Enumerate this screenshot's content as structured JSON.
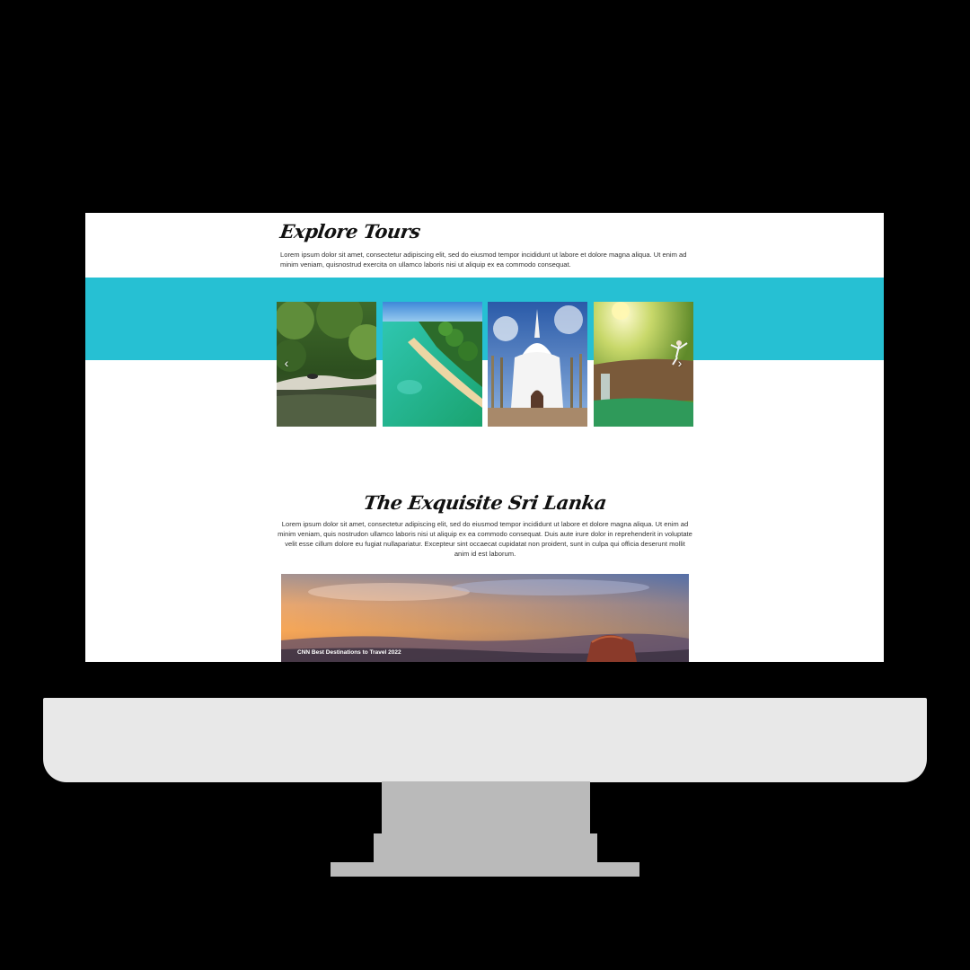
{
  "explore": {
    "title": "Explore Tours",
    "text": "Lorem ipsum dolor sit amet, consectetur adipiscing elit, sed do eiusmod tempor incididunt ut labore et dolore magna aliqua. Ut enim ad minim veniam, quisnostrud exercita on ullamco laboris nisi ut aliquip ex ea commodo consequat."
  },
  "carousel": {
    "prev_icon": "chevron-left-icon",
    "next_icon": "chevron-right-icon",
    "prev_glyph": "‹",
    "next_glyph": "›",
    "slides": [
      "jungle-river",
      "tropical-beach",
      "white-stupa",
      "waterfall-yoga"
    ]
  },
  "exquisite": {
    "title": "The Exquisite Sri Lanka",
    "text": "Lorem ipsum dolor sit amet, consectetur adipiscing elit, sed do eiusmod tempor incididunt ut labore et dolore magna aliqua. Ut enim ad minim veniam, quis nostrudon ullamco laboris nisi ut aliquip ex ea commodo consequat. Duis aute irure dolor in reprehenderit in voluptate velit esse cillum dolore eu fugiat nullapariatur. Excepteur sint occaecat cupidatat non proident, sunt in culpa qui officia deserunt mollit anim id est laborum."
  },
  "hero": {
    "caption": "CNN Best Destinations to Travel 2022"
  },
  "colors": {
    "accent": "#26c0d3",
    "bezel": "#e8e8e8",
    "stand": "#bababa"
  }
}
